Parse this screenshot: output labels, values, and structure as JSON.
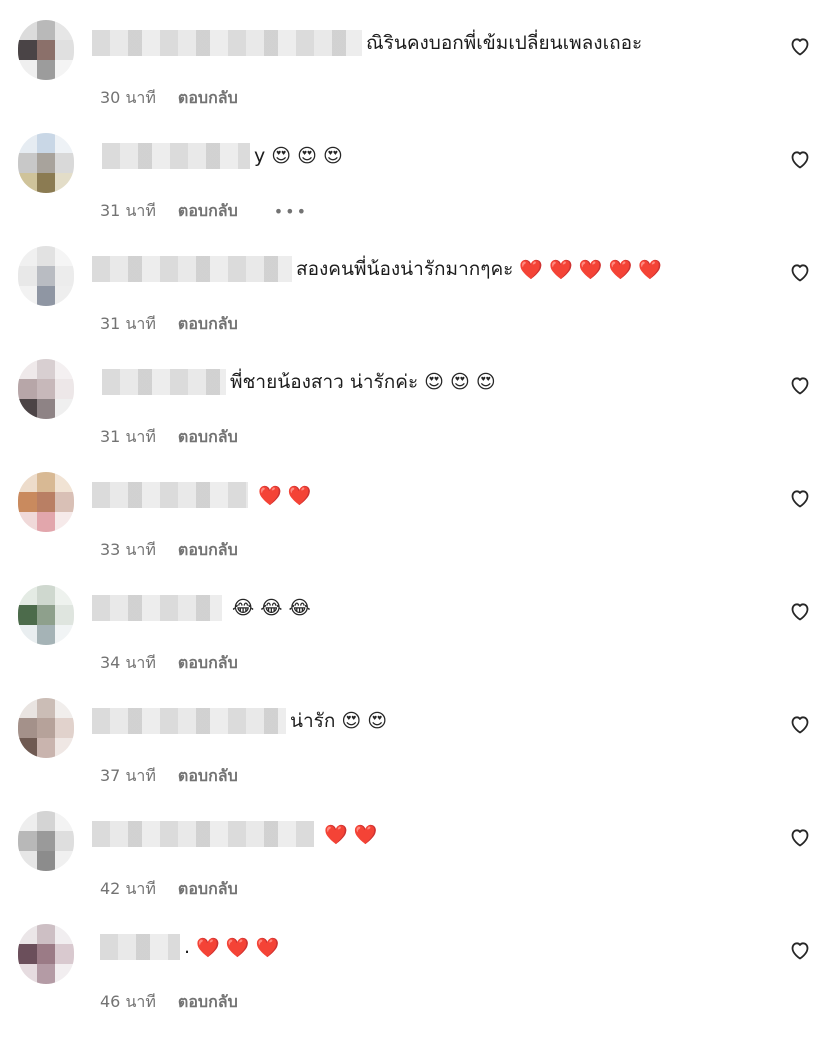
{
  "comments": [
    {
      "text": "ณิรินคงบอกพี่เข้มเปลี่ยนเพลงเถอะ",
      "prefix": "",
      "emoji": "",
      "time": "30 นาที",
      "reply": "ตอบกลับ",
      "more": ""
    },
    {
      "text": "",
      "prefix": "y",
      "emoji": "😍 😍 😍",
      "time": "31 นาที",
      "reply": "ตอบกลับ",
      "more": "•••"
    },
    {
      "text": "สองคนพี่น้องน่ารักมากๆคะ",
      "prefix": "",
      "emoji": "❤️ ❤️ ❤️ ❤️ ❤️",
      "time": "31 นาที",
      "reply": "ตอบกลับ",
      "more": ""
    },
    {
      "text": "พี่ชายน้องสาว น่ารักค่ะ",
      "prefix": "",
      "emoji": "😍 😍 😍",
      "time": "31 นาที",
      "reply": "ตอบกลับ",
      "more": ""
    },
    {
      "text": "",
      "prefix": "",
      "emoji": "❤️ ❤️",
      "time": "33 นาที",
      "reply": "ตอบกลับ",
      "more": ""
    },
    {
      "text": "",
      "prefix": "",
      "emoji": "😂 😂 😂",
      "time": "34 นาที",
      "reply": "ตอบกลับ",
      "more": ""
    },
    {
      "text": "น่ารัก",
      "prefix": "",
      "emoji": "😍 😍",
      "time": "37 นาที",
      "reply": "ตอบกลับ",
      "more": ""
    },
    {
      "text": "",
      "prefix": "",
      "emoji": "❤️ ❤️",
      "time": "42 นาที",
      "reply": "ตอบกลับ",
      "more": ""
    },
    {
      "text": "",
      "prefix": ".",
      "emoji": "❤️ ❤️ ❤️",
      "time": "46 นาที",
      "reply": "ตอบกลับ",
      "more": ""
    }
  ],
  "icons": {
    "like": "heart-outline-icon"
  }
}
